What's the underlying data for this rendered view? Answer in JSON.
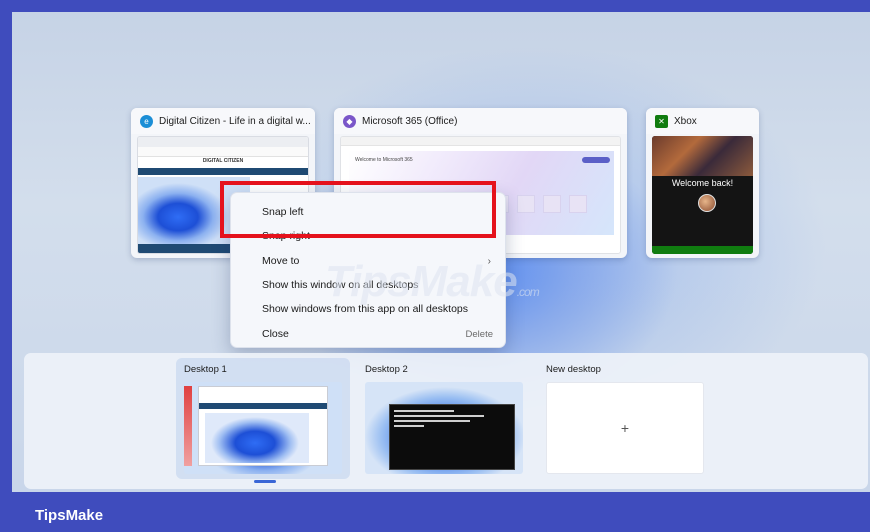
{
  "windows": [
    {
      "title": "Digital Citizen - Life in a digital w...",
      "icon": "edge-icon",
      "page_brand": "DIGITAL CITIZEN"
    },
    {
      "title": "Microsoft 365 (Office)",
      "icon": "office-icon",
      "welcome": "Welcome to Microsoft 365"
    },
    {
      "title": "Xbox",
      "icon": "xbox-icon",
      "welcome": "Welcome back!"
    }
  ],
  "context_menu": {
    "items": [
      {
        "label": "Snap left"
      },
      {
        "label": "Snap right"
      },
      {
        "label": "Move to",
        "submenu": true
      },
      {
        "label": "Show this window on all desktops"
      },
      {
        "label": "Show windows from this app on all desktops"
      },
      {
        "label": "Close",
        "accelerator": "Delete"
      }
    ],
    "highlight_color": "#e5121c"
  },
  "desktops": [
    {
      "label": "Desktop 1",
      "active": true
    },
    {
      "label": "Desktop 2",
      "active": false
    },
    {
      "label": "New desktop",
      "add_symbol": "+"
    }
  ],
  "watermark": {
    "main": "TipsMake",
    "suffix": ".com"
  },
  "footer": {
    "brand": "TipsMake"
  },
  "colors": {
    "frame": "#3f4cbd",
    "accent": "#3a66d6"
  }
}
